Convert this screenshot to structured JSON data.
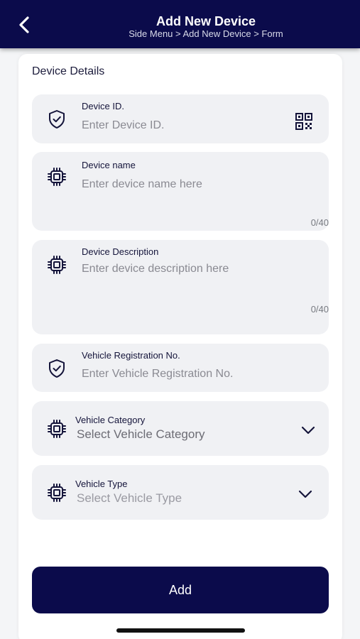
{
  "header": {
    "title": "Add New Device",
    "breadcrumb": "Side Menu > Add New Device > Form"
  },
  "form": {
    "section_title": "Device Details",
    "device_id": {
      "label": "Device ID.",
      "placeholder": "Enter Device ID."
    },
    "device_name": {
      "label": "Device name",
      "placeholder": "Enter device name here",
      "counter": "0/40"
    },
    "device_description": {
      "label": "Device Description",
      "placeholder": "Enter device description here",
      "counter": "0/40"
    },
    "vehicle_registration": {
      "label": "Vehicle Registration No.",
      "placeholder": "Enter Vehicle Registration No."
    },
    "vehicle_category": {
      "label": "Vehicle Category",
      "value": "Select Vehicle Category"
    },
    "vehicle_type": {
      "label": "Vehicle Type",
      "value": "Select Vehicle Type"
    },
    "submit_label": "Add"
  },
  "icons": {
    "back": "chevron-left-icon",
    "shield": "shield-check-icon",
    "chip": "chip-icon",
    "qr": "qr-code-icon",
    "chevron": "chevron-down-icon"
  },
  "colors": {
    "primary": "#0b0b4b",
    "field_bg": "#f0f1f4",
    "page_bg": "#f4f5f7"
  }
}
